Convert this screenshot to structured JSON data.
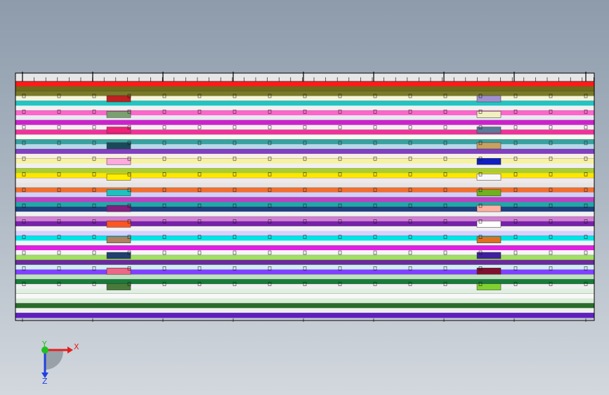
{
  "viewport": {
    "background_top": "#8d9bab",
    "background_bottom": "#d3d8de"
  },
  "model": {
    "frame_color": "#000000",
    "bands": [
      {
        "color": "#ff1a1a"
      },
      {
        "color": "#6b6b1a"
      },
      {
        "color": "#7a7a2a"
      },
      {
        "color": "#f5f5dc"
      },
      {
        "color": "#22c4c4"
      },
      {
        "color": "#f0f0f0"
      },
      {
        "color": "#ff66cc"
      },
      {
        "color": "#e8e8f0"
      },
      {
        "color": "#cc22cc"
      },
      {
        "color": "#f5f0f0"
      },
      {
        "color": "#ee3399"
      },
      {
        "color": "#f0fff0"
      },
      {
        "color": "#3aa0a0"
      },
      {
        "color": "#b8d8e8"
      },
      {
        "color": "#8040c0"
      },
      {
        "color": "#f8f0e0"
      },
      {
        "color": "#f7f2a0"
      },
      {
        "color": "#f0f0f0"
      },
      {
        "color": "#aacc33"
      },
      {
        "color": "#ffe600"
      },
      {
        "color": "#f0e8e8"
      },
      {
        "color": "#e5e5e5"
      },
      {
        "color": "#f07030"
      },
      {
        "color": "#d0d0ff"
      },
      {
        "color": "#c040c0"
      },
      {
        "color": "#20a8a8"
      },
      {
        "color": "#204080"
      },
      {
        "color": "#f0f0f0"
      },
      {
        "color": "#d080d0"
      },
      {
        "color": "#7722aa"
      },
      {
        "color": "#f0f0f0"
      },
      {
        "color": "#d8d0ff"
      },
      {
        "color": "#00e5e5"
      },
      {
        "color": "#e8f8f8"
      },
      {
        "color": "#e020e0"
      },
      {
        "color": "#f5f5f5"
      },
      {
        "color": "#a0e060"
      },
      {
        "color": "#6a2a9a"
      },
      {
        "color": "#d0f0f0"
      },
      {
        "color": "#8040ff"
      },
      {
        "color": "#c0e0c0"
      },
      {
        "color": "#1a7a3a"
      },
      {
        "color": "#f0f0f0"
      },
      {
        "color": "#e0f0e0"
      },
      {
        "color": "#f8f8f8"
      },
      {
        "color": "#d8ecd8"
      },
      {
        "color": "#2a6a2a"
      },
      {
        "color": "#f0f0f0"
      },
      {
        "color": "#6020c0"
      }
    ],
    "left_blocks": [
      {
        "color": "#c02020"
      },
      {
        "color": "#7aa070"
      },
      {
        "color": "#ee2277"
      },
      {
        "color": "#1a4a5a"
      },
      {
        "color": "#ffaadd"
      },
      {
        "color": "#ffee00"
      },
      {
        "color": "#20c0c0"
      },
      {
        "color": "#802080"
      },
      {
        "color": "#ff5522"
      },
      {
        "color": "#b08060"
      },
      {
        "color": "#204070"
      },
      {
        "color": "#ee6688"
      },
      {
        "color": "#4a7a3a"
      }
    ],
    "right_blocks": [
      {
        "color": "#a090d0"
      },
      {
        "color": "#f0f0c0"
      },
      {
        "color": "#5a7a9a"
      },
      {
        "color": "#c8a060"
      },
      {
        "color": "#1020c0"
      },
      {
        "color": "#f8f8f8"
      },
      {
        "color": "#70b020"
      },
      {
        "color": "#ffb0a0"
      },
      {
        "color": "#ffffff"
      },
      {
        "color": "#e07020"
      },
      {
        "color": "#4020a0"
      },
      {
        "color": "#801030"
      },
      {
        "color": "#80d030"
      }
    ]
  },
  "triad": {
    "x_label": "X",
    "y_label": "Y",
    "z_label": "Z",
    "x_color": "#e02020",
    "y_color": "#20c020",
    "z_color": "#2040e0"
  }
}
